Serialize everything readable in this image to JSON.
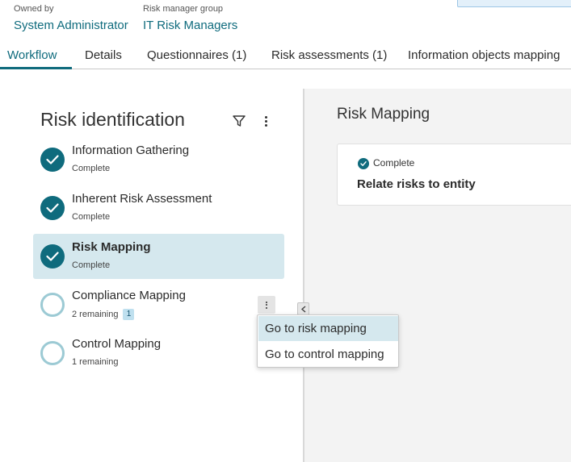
{
  "header": {
    "owned_by_label": "Owned by",
    "owned_by_value": "System Administrator",
    "risk_group_label": "Risk manager group",
    "risk_group_value": "IT Risk Managers"
  },
  "tabs": [
    {
      "label": "Workflow",
      "active": true
    },
    {
      "label": "Details",
      "active": false
    },
    {
      "label": "Questionnaires (1)",
      "active": false
    },
    {
      "label": "Risk assessments (1)",
      "active": false
    },
    {
      "label": "Information objects mapping",
      "active": false
    }
  ],
  "left_panel": {
    "title": "Risk identification",
    "filter_icon": "filter-icon",
    "more_icon": "more-vertical-icon",
    "steps": [
      {
        "name": "Information Gathering",
        "status": "Complete",
        "state": "complete",
        "selected": false
      },
      {
        "name": "Inherent Risk Assessment",
        "status": "Complete",
        "state": "complete",
        "selected": false
      },
      {
        "name": "Risk Mapping",
        "status": "Complete",
        "state": "complete",
        "selected": true
      },
      {
        "name": "Compliance Mapping",
        "status": "2 remaining",
        "badge": "1",
        "state": "pending",
        "selected": false
      },
      {
        "name": "Control Mapping",
        "status": "1 remaining",
        "state": "pending",
        "selected": false
      }
    ]
  },
  "context_menu": {
    "items": [
      "Go to risk mapping",
      "Go to control mapping"
    ],
    "hovered_index": 0
  },
  "right_panel": {
    "title": "Risk Mapping",
    "task": {
      "status": "Complete",
      "name": "Relate risks to entity"
    }
  },
  "colors": {
    "accent": "#0f6b7d",
    "selected_bg": "#d5e8ee",
    "pending_ring": "#9ccad4",
    "badge_bg": "#bfe0ef"
  }
}
